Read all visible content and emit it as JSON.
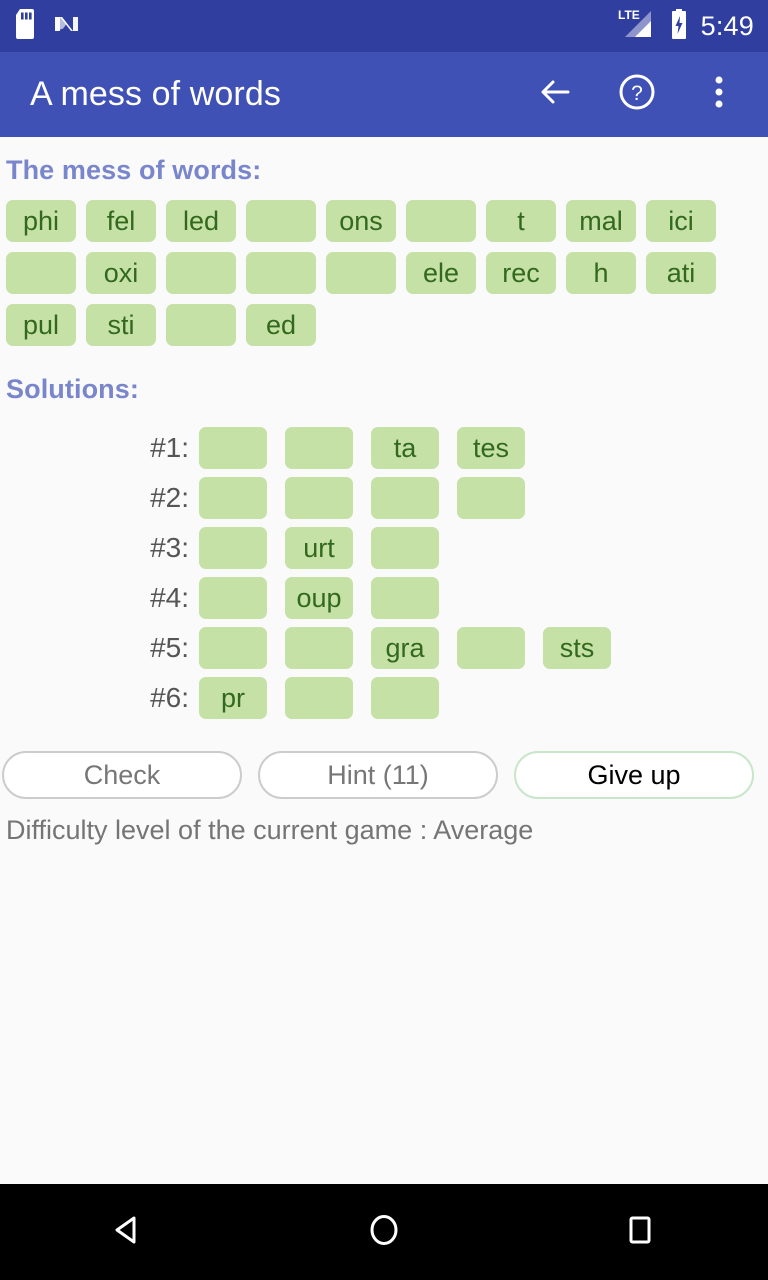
{
  "status_bar": {
    "time": "5:49",
    "icons": [
      "sd-card-icon",
      "android-n-logo-icon",
      "lte-signal-icon",
      "battery-charging-icon"
    ],
    "network_label": "LTE",
    "background_color": "#303f9f"
  },
  "app_bar": {
    "title": "A mess of words",
    "background_color": "#3f51b5",
    "actions": [
      {
        "name": "back-button",
        "icon": "arrow-left-icon"
      },
      {
        "name": "help-button",
        "icon": "question-circle-icon"
      },
      {
        "name": "overflow-menu-button",
        "icon": "more-vertical-icon"
      }
    ]
  },
  "mess": {
    "heading": "The mess of words:",
    "heading_color": "#7986cb",
    "chip_color": "#c5e1a5",
    "rows": [
      [
        "phi",
        "fel",
        "led",
        "",
        "ons",
        "",
        "t",
        "mal",
        "ici"
      ],
      [
        "",
        "oxi",
        "",
        "",
        "",
        "ele",
        "rec",
        "h",
        "ati"
      ],
      [
        "pul",
        "sti",
        "",
        "ed"
      ]
    ]
  },
  "solutions": {
    "heading": "Solutions:",
    "heading_color": "#7986cb",
    "rows": [
      {
        "label": "#1:",
        "chips": [
          "",
          "",
          "ta",
          "tes"
        ]
      },
      {
        "label": "#2:",
        "chips": [
          "",
          "",
          "",
          ""
        ]
      },
      {
        "label": "#3:",
        "chips": [
          "",
          "urt",
          ""
        ]
      },
      {
        "label": "#4:",
        "chips": [
          "",
          "oup",
          ""
        ]
      },
      {
        "label": "#5:",
        "chips": [
          "",
          "",
          "gra",
          "",
          "sts"
        ]
      },
      {
        "label": "#6:",
        "chips": [
          "pr",
          "",
          ""
        ]
      }
    ]
  },
  "buttons": [
    {
      "name": "check-button",
      "label": "Check",
      "primary": false
    },
    {
      "name": "hint-button",
      "label": "Hint (11)",
      "primary": false
    },
    {
      "name": "give-up-button",
      "label": "Give up",
      "primary": true
    }
  ],
  "difficulty": {
    "text": "Difficulty level of the current game : Average"
  },
  "nav_bar": {
    "buttons": [
      {
        "name": "nav-back-button",
        "icon": "triangle-left-icon"
      },
      {
        "name": "nav-home-button",
        "icon": "circle-icon"
      },
      {
        "name": "nav-recents-button",
        "icon": "square-icon"
      }
    ]
  }
}
